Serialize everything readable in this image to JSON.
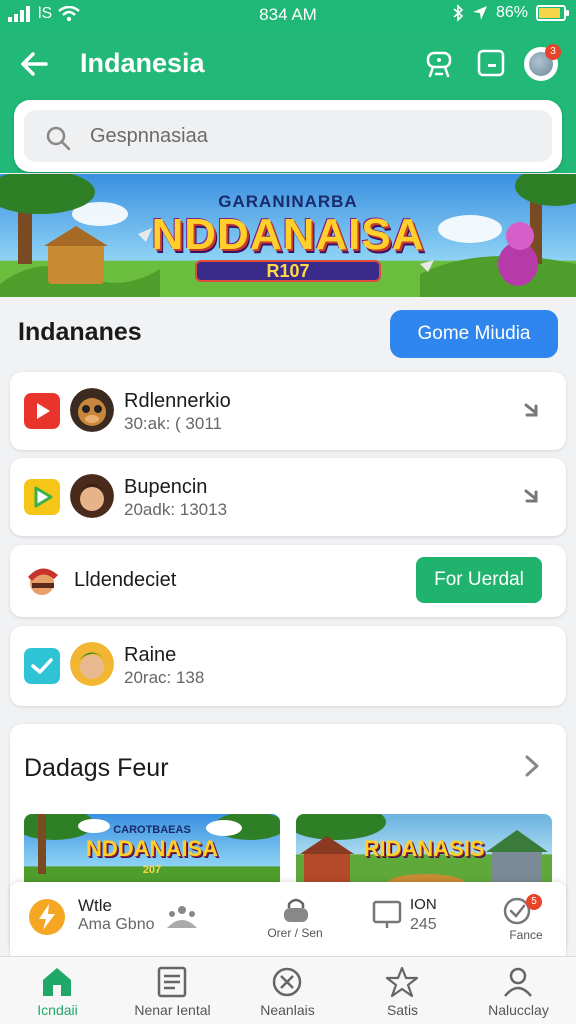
{
  "status_bar": {
    "signal": "ull",
    "carrier": "lS",
    "time": "834 AM",
    "battery_percent": "86%",
    "battery_level": 0.86
  },
  "app_bar": {
    "title": "Indanesia",
    "notification_count": "3"
  },
  "search": {
    "placeholder": "Gespnnasiaa"
  },
  "banner": {
    "kicker": "GARANINARBA",
    "headline": "NDDANAISA",
    "ribbon": "R107"
  },
  "list_section": {
    "title": "Indananes",
    "action_label": "Gome Miudia",
    "items": [
      {
        "name": "Rdlennerkio",
        "meta": "30:ak: ( 3011"
      },
      {
        "name": "Bupencin",
        "meta": "20adk: 13013"
      },
      {
        "name": "Lldendeciet",
        "button_label": "For Uerdal"
      },
      {
        "name": "Raine",
        "meta": "20rac: 138"
      }
    ]
  },
  "feature": {
    "title": "Dadags Feur",
    "thumb_1": {
      "kicker": "CAROTBAEAS",
      "headline": "NDDANAISA",
      "subtitle": "207"
    },
    "thumb_2": {
      "headline": "RIDANASIS"
    }
  },
  "mini_strip": {
    "card_1": {
      "title": "Wtle",
      "subtitle": "Ama Gbno"
    },
    "card_2": {
      "label": "Orer / Sen"
    },
    "card_3": {
      "title": "ION",
      "value": "245"
    },
    "card_4": {
      "label": "Fance",
      "badge": "5"
    }
  },
  "bottom_nav": [
    {
      "label": "Icndaii"
    },
    {
      "label": "Nenar Iental"
    },
    {
      "label": "Neanlais"
    },
    {
      "label": "Satis"
    },
    {
      "label": "Nalucclay"
    }
  ],
  "colors": {
    "primary_green": "#22b878",
    "accent_blue": "#2f86ee",
    "button_green": "#1fb36e",
    "badge_red": "#e8442b"
  }
}
